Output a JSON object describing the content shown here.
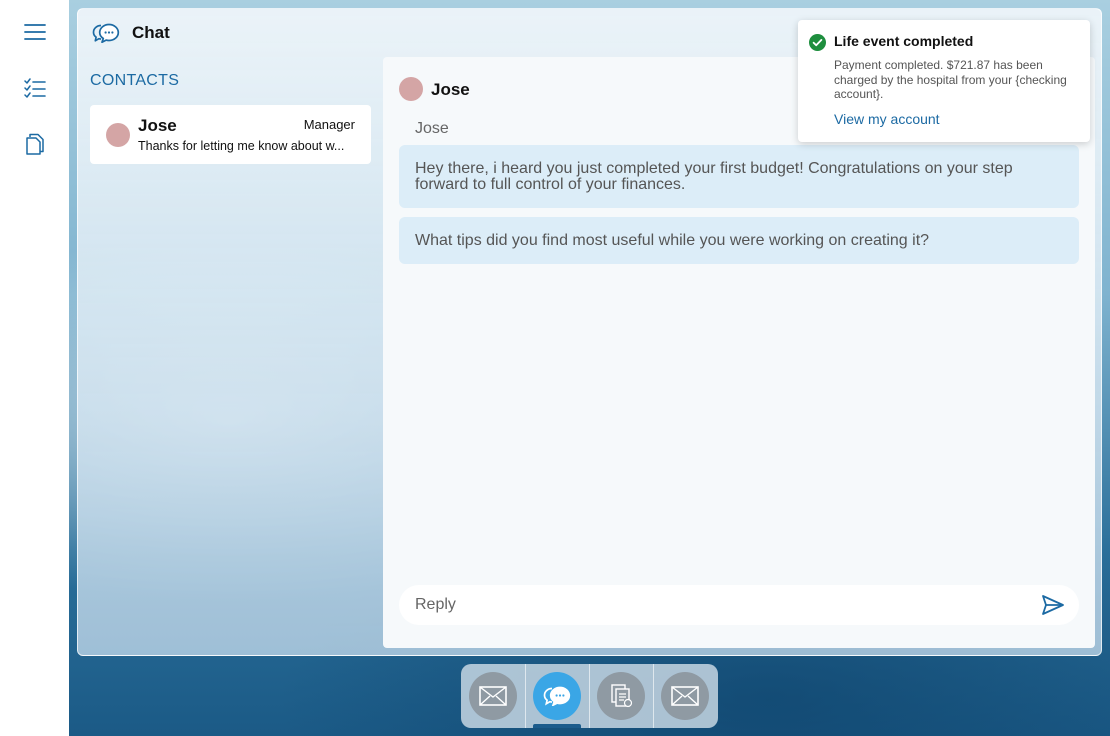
{
  "rail": {
    "items": [
      {
        "icon": "menu-icon"
      },
      {
        "icon": "checklist-icon"
      },
      {
        "icon": "document-icon"
      }
    ]
  },
  "window": {
    "title": "Chat",
    "icon": "chat-bubbles-icon"
  },
  "contacts": {
    "heading": "CONTACTS",
    "items": [
      {
        "name": "Jose",
        "role": "Manager",
        "preview": "Thanks for letting me know about w..."
      }
    ]
  },
  "conversation": {
    "contact_name": "Jose",
    "sender_label": "Jose",
    "messages": [
      "Hey there, i heard you just completed your first budget! Congratulations on your step forward to full control of your finances.",
      "What tips did you find most useful while you were working on creating it?"
    ],
    "reply_placeholder": "Reply"
  },
  "toast": {
    "title": "Life event completed",
    "body": "Payment completed. $721.87 has been charged by the hospital from your {checking account}.",
    "link": "View my account"
  },
  "dock": {
    "items": [
      {
        "icon": "mail-icon",
        "active": false
      },
      {
        "icon": "chat-icon",
        "active": true
      },
      {
        "icon": "bills-icon",
        "active": false
      },
      {
        "icon": "mail-icon",
        "active": false
      }
    ]
  },
  "colors": {
    "accent": "#1c6aa3",
    "bubble": "#dcedf8",
    "avatar": "#d4a5a5",
    "success": "#1e8e3e",
    "dock_active": "#3aa6e6"
  }
}
